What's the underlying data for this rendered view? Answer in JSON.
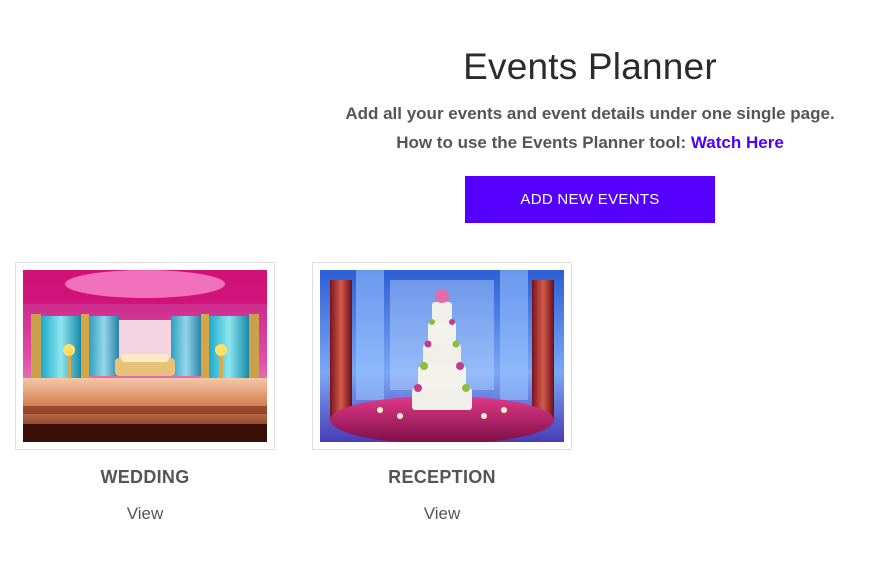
{
  "header": {
    "title": "Events Planner",
    "subtitle": "Add all your events and event details under one single page.",
    "howto_prefix": "How to use the Events Planner tool: ",
    "howto_link": "Watch Here",
    "add_button": "ADD NEW EVENTS"
  },
  "events": [
    {
      "title": "WEDDING",
      "view": "View",
      "image": "wedding-stage-photo"
    },
    {
      "title": "RECEPTION",
      "view": "View",
      "image": "reception-cake-photo"
    }
  ],
  "colors": {
    "accent": "#5500ff",
    "link": "#4f00ff"
  }
}
